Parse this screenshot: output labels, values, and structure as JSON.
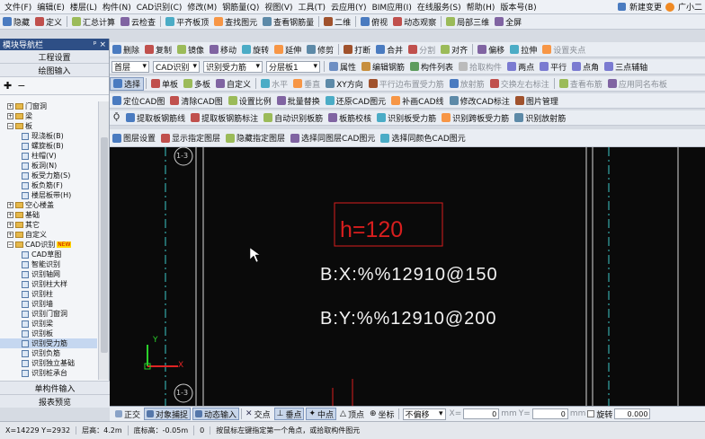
{
  "menu": [
    "文件(F)",
    "编辑(E)",
    "楼层(L)",
    "构件(N)",
    "CAD识别(C)",
    "修改(M)",
    "钢筋量(Q)",
    "视图(V)",
    "工具(T)",
    "云应用(Y)",
    "BIM应用(I)",
    "在线服务(S)",
    "帮助(H)",
    "版本号(B)"
  ],
  "menu_right": {
    "new_change": "新建变更",
    "user": "广小二"
  },
  "toolbar1": [
    "隐藏",
    "定义",
    "汇总计算",
    "云检查",
    "平齐板顶",
    "查找图元",
    "查看钢筋量",
    "二维",
    "俯视",
    "动态观察",
    "局部三维",
    "全屏"
  ],
  "toolbar2": [
    "删除",
    "复制",
    "镜像",
    "移动",
    "旋转",
    "延伸",
    "修剪",
    "打断",
    "合并",
    "分割",
    "对齐",
    "偏移",
    "拉伸",
    "设置夹点"
  ],
  "toolbar3": {
    "floor": "首层",
    "category": "CAD识别",
    "sub": "识别受力筋",
    "layer": "分层板1",
    "attr": "属性",
    "edit_rebar": "编辑钢筋",
    "member_list": "构件列表",
    "pick": "拾取构件",
    "two_point": "两点",
    "parallel": "平行",
    "point_angle": "点角",
    "three_axis": "三点辅轴"
  },
  "toolbar4": [
    "选择",
    "单板",
    "多板",
    "自定义",
    "水平",
    "垂直",
    "XY方向",
    "平行边布置受力筋",
    "放射筋",
    "交换左右标注",
    "查看布筋",
    "应用同名布板"
  ],
  "toolbar5": [
    "定位CAD图",
    "清除CAD图",
    "设置比例",
    "批量替换",
    "还原CAD图元",
    "补画CAD线",
    "修改CAD标注",
    "图片管理"
  ],
  "toolbar6": [
    "提取板钢筋线",
    "提取板钢筋标注",
    "自动识别板筋",
    "板筋校核",
    "识别板受力筋",
    "识别跨板受力筋",
    "识别放射筋"
  ],
  "toolbar7": [
    "图层设置",
    "显示指定图层",
    "隐藏指定图层",
    "选择同图层CAD图元",
    "选择同颜色CAD图元"
  ],
  "panel": {
    "title": "模块导航栏",
    "pin": "ᵖ ×",
    "btn1": "工程设置",
    "btn2": "绘图输入",
    "tree": [
      {
        "label": "门窗洞",
        "kind": "folder",
        "exp": "+",
        "indent": 0
      },
      {
        "label": "梁",
        "kind": "folder",
        "exp": "+",
        "indent": 0
      },
      {
        "label": "板",
        "kind": "folder",
        "exp": "−",
        "indent": 0
      },
      {
        "label": "现浇板(B)",
        "kind": "leaf",
        "indent": 1
      },
      {
        "label": "螺旋板(B)",
        "kind": "leaf",
        "indent": 1
      },
      {
        "label": "柱帽(V)",
        "kind": "leaf",
        "indent": 1
      },
      {
        "label": "板洞(N)",
        "kind": "leaf",
        "indent": 1
      },
      {
        "label": "板受力筋(S)",
        "kind": "leaf",
        "indent": 1
      },
      {
        "label": "板负筋(F)",
        "kind": "leaf",
        "indent": 1
      },
      {
        "label": "楼层板带(H)",
        "kind": "leaf",
        "indent": 1
      },
      {
        "label": "空心楼盖",
        "kind": "folder",
        "exp": "+",
        "indent": 0
      },
      {
        "label": "基础",
        "kind": "folder",
        "exp": "+",
        "indent": 0
      },
      {
        "label": "其它",
        "kind": "folder",
        "exp": "+",
        "indent": 0
      },
      {
        "label": "自定义",
        "kind": "folder",
        "exp": "+",
        "indent": 0
      },
      {
        "label": "CAD识别",
        "kind": "folder",
        "exp": "−",
        "indent": 0,
        "badge": "NEW"
      },
      {
        "label": "CAD草图",
        "kind": "leaf",
        "indent": 1
      },
      {
        "label": "智能识别",
        "kind": "leaf",
        "indent": 1
      },
      {
        "label": "识别轴网",
        "kind": "leaf",
        "indent": 1
      },
      {
        "label": "识别柱大样",
        "kind": "leaf",
        "indent": 1
      },
      {
        "label": "识别柱",
        "kind": "leaf",
        "indent": 1
      },
      {
        "label": "识别墙",
        "kind": "leaf",
        "indent": 1
      },
      {
        "label": "识别门窗洞",
        "kind": "leaf",
        "indent": 1
      },
      {
        "label": "识别梁",
        "kind": "leaf",
        "indent": 1
      },
      {
        "label": "识别板",
        "kind": "leaf",
        "indent": 1
      },
      {
        "label": "识别受力筋",
        "kind": "leaf",
        "indent": 1,
        "selected": true
      },
      {
        "label": "识别负筋",
        "kind": "leaf",
        "indent": 1
      },
      {
        "label": "识别独立基础",
        "kind": "leaf",
        "indent": 1
      },
      {
        "label": "识别桩承台",
        "kind": "leaf",
        "indent": 1
      }
    ],
    "foot1": "单构件输入",
    "foot2": "报表预览"
  },
  "canvas": {
    "axis_top": "1-3",
    "axis_bottom": "1-3",
    "h_label": "h=120",
    "bx": "B:X:%%12910@150",
    "by": "B:Y:%%12910@200",
    "ucs_x": "X",
    "ucs_y": "Y"
  },
  "status": {
    "ortho": "正交",
    "snap": "对象捕捉",
    "dyn": "动态输入",
    "inter": "交点",
    "perp": "垂点",
    "mid": "中点",
    "vertex": "顶点",
    "coord": "坐标",
    "offset": "不偏移",
    "x_label": "X=",
    "x_val": "0",
    "mm1": "mm",
    "y_label": "Y=",
    "y_val": "0",
    "mm2": "mm",
    "rotate": "旋转",
    "rot_val": "0.000"
  },
  "info": {
    "coords": "X=14229 Y=2932",
    "floor_h": "层高：4.2m",
    "base_h": "底标高：-0.05m",
    "zero": "0",
    "hint": "按鼠标左键指定第一个角点，或拾取构件图元"
  },
  "colors": {
    "accent": "#2e4f86",
    "cad_red": "#d81e1e",
    "cad_cyan": "#3cc8c8",
    "text_white": "#f2f2f2"
  }
}
